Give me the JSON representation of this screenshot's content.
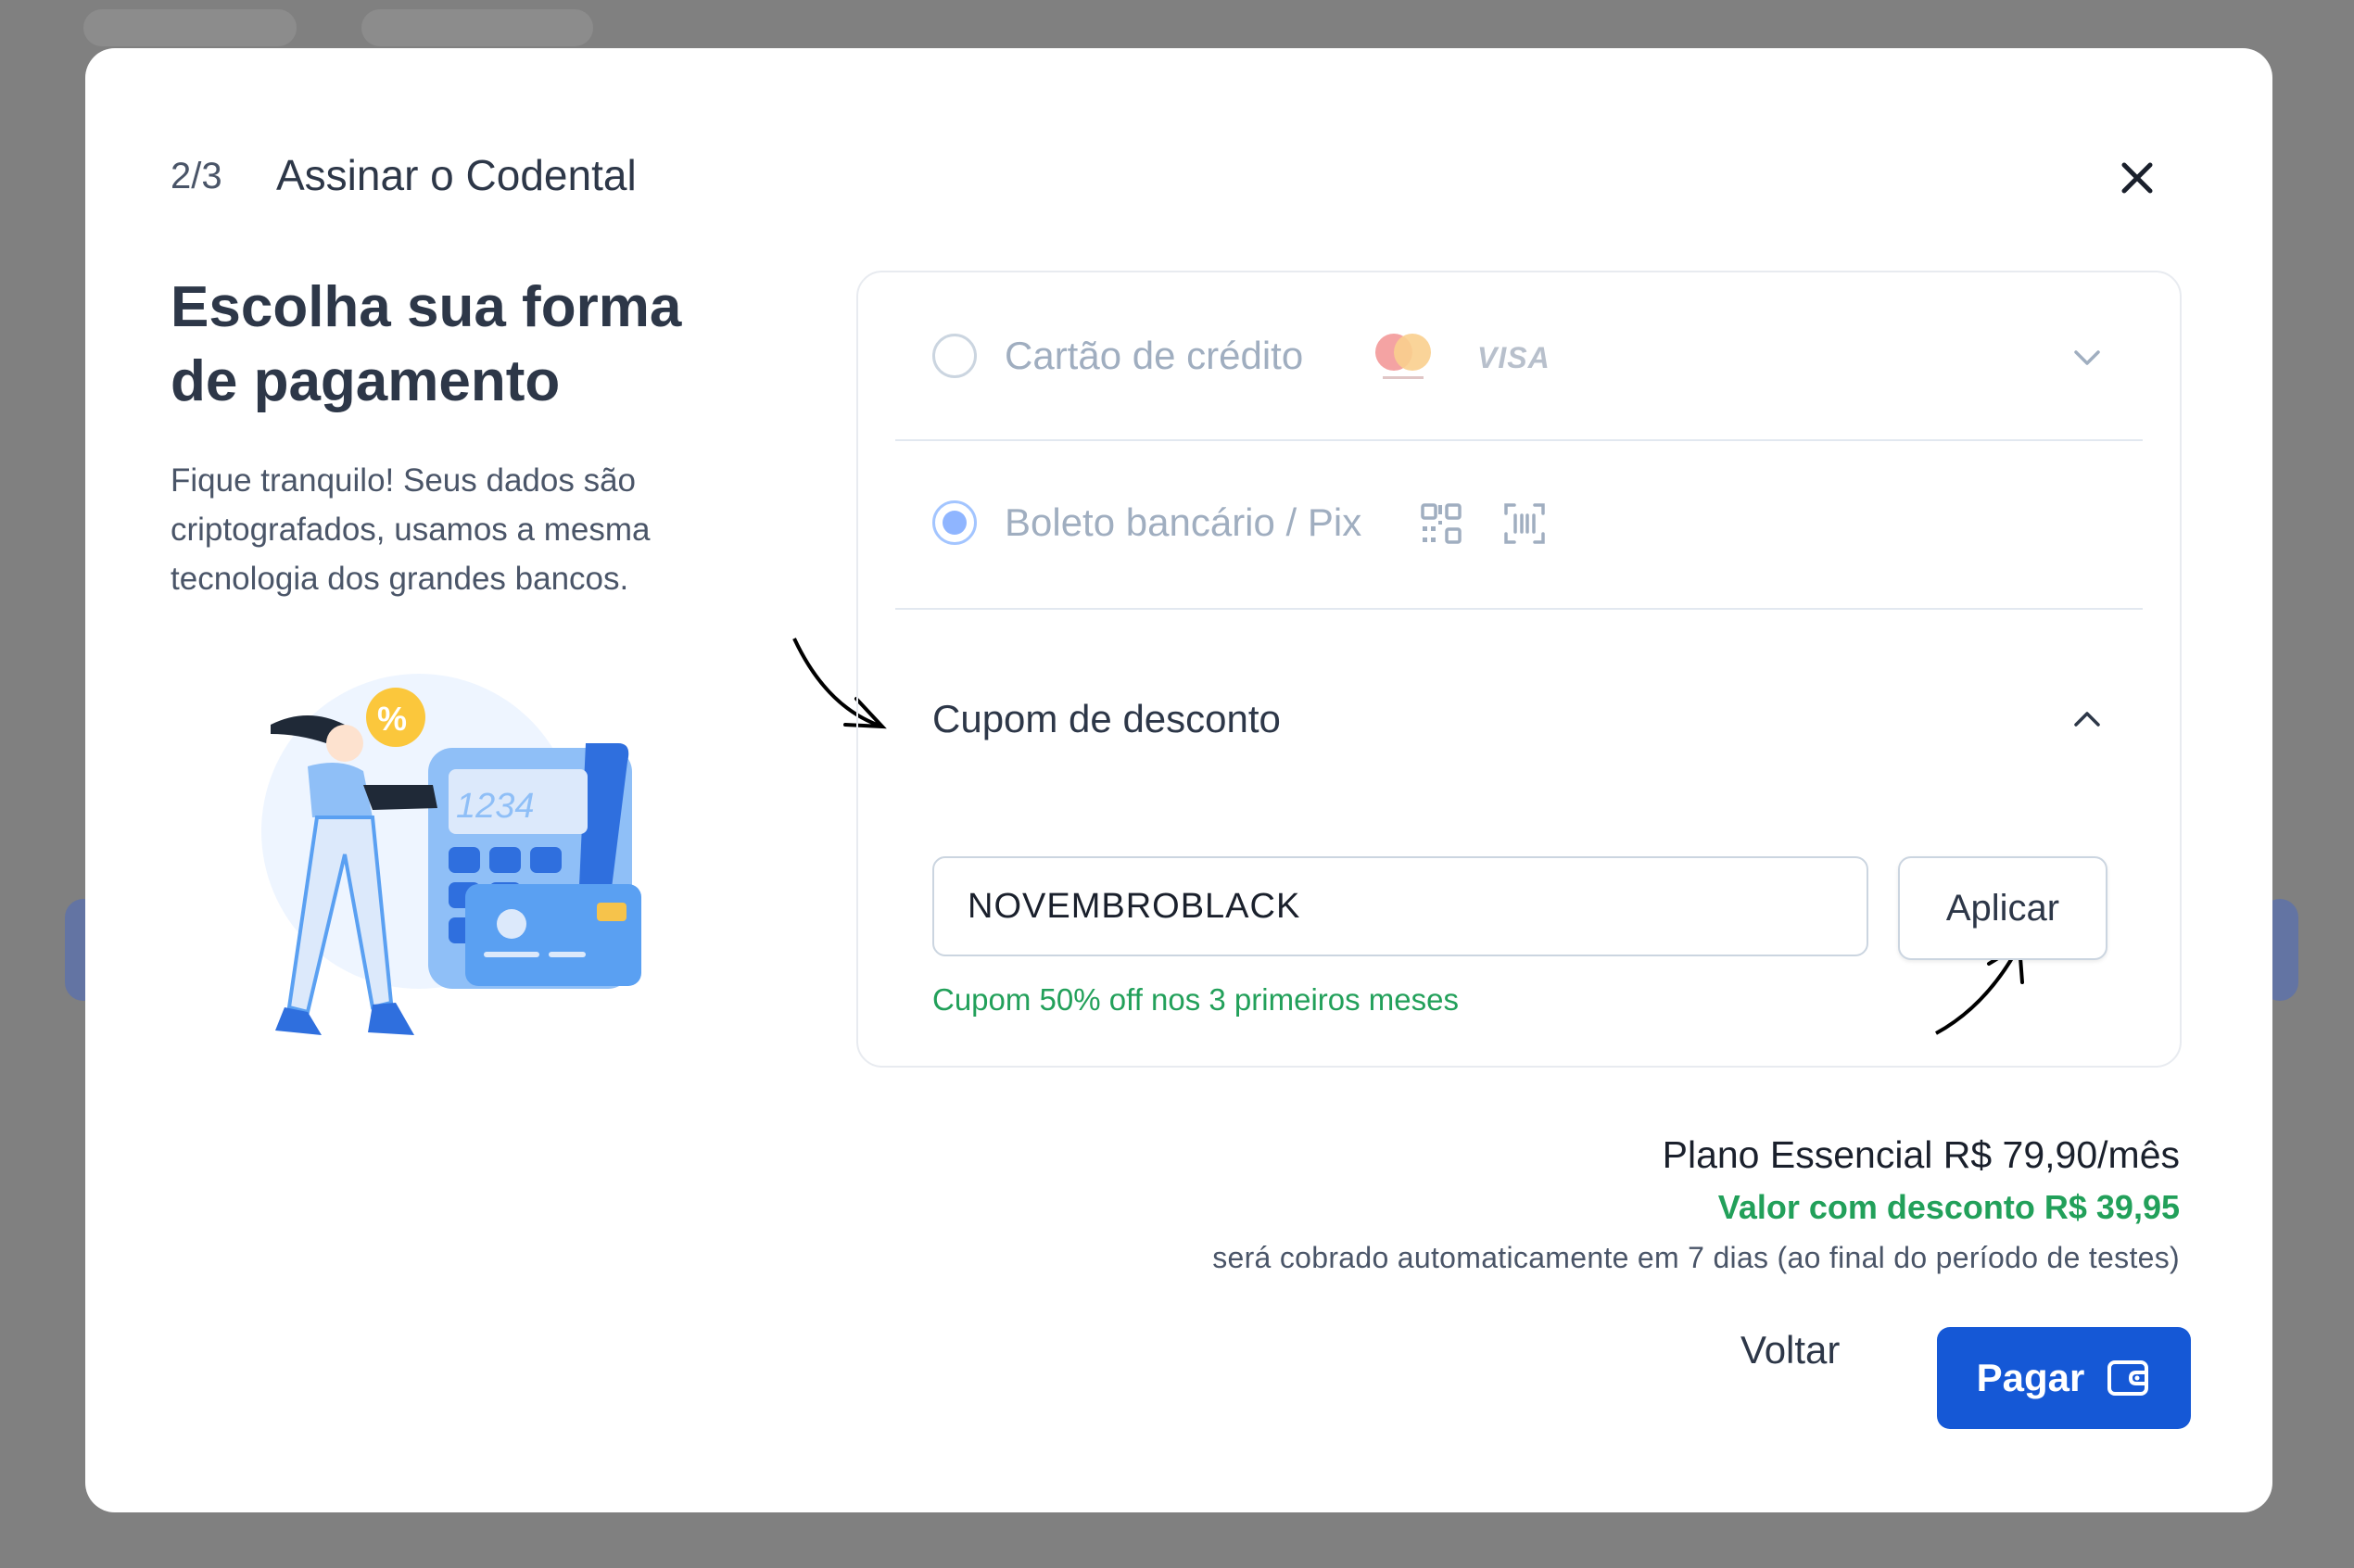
{
  "modal": {
    "step": "2/3",
    "title": "Assinar o Codental",
    "heading": "Escolha sua forma de pagamento",
    "subtext": "Fique tranquilo! Seus dados são criptografados, usamos a mesma tecnologia dos grandes bancos.",
    "illustration_text": "1234",
    "illustration_badge": "%"
  },
  "payment_options": [
    {
      "label": "Cartão de crédito",
      "selected": false,
      "icons": [
        "mastercard-icon",
        "visa-icon"
      ],
      "visa_text": "VISA"
    },
    {
      "label": "Boleto bancário / Pix",
      "selected": true,
      "icons": [
        "qr-code-icon",
        "barcode-icon"
      ]
    }
  ],
  "coupon": {
    "title": "Cupom de desconto",
    "value": "NOVEMBROBLACK",
    "apply_label": "Aplicar",
    "success_message": "Cupom 50% off nos 3 primeiros meses"
  },
  "pricing": {
    "plan": "Plano Essencial R$ 79,90/mês",
    "discounted": "Valor com desconto R$ 39,95",
    "note": "será cobrado automaticamente em 7 dias (ao final do período de testes)"
  },
  "actions": {
    "back_label": "Voltar",
    "pay_label": "Pagar"
  },
  "colors": {
    "primary": "#1558d6",
    "success": "#22a05a",
    "backdrop": "#808080"
  }
}
